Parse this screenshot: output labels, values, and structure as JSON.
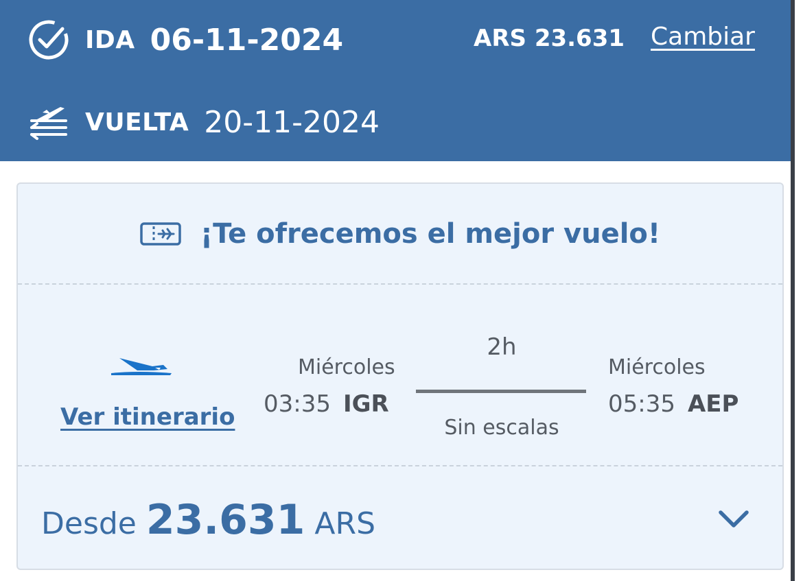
{
  "header": {
    "outbound": {
      "label": "IDA",
      "date": "06-11-2024",
      "icon": "check-circle-icon"
    },
    "return": {
      "label": "VUELTA",
      "date": "20-11-2024",
      "icon": "plane-arrows-icon"
    },
    "price": "ARS 23.631",
    "change_link": "Cambiar"
  },
  "card": {
    "offer_text": "¡Te ofrecemos el mejor vuelo!",
    "offer_icon": "ticket-icon",
    "airline_icon": "airline-logo-icon",
    "itinerary_link": "Ver itinerario",
    "departure": {
      "day": "Miércoles",
      "time": "03:35",
      "airport": "IGR"
    },
    "arrival": {
      "day": "Miércoles",
      "time": "05:35",
      "airport": "AEP"
    },
    "duration": "2h",
    "stops": "Sin escalas",
    "fare": {
      "prefix": "Desde",
      "amount": "23.631",
      "currency": "ARS"
    },
    "expand_icon": "chevron-down-icon"
  },
  "colors": {
    "header_bg": "#3b6da4",
    "card_bg": "#edf4fc",
    "accent": "#3b6da4",
    "airline_blue": "#1a73c9"
  }
}
